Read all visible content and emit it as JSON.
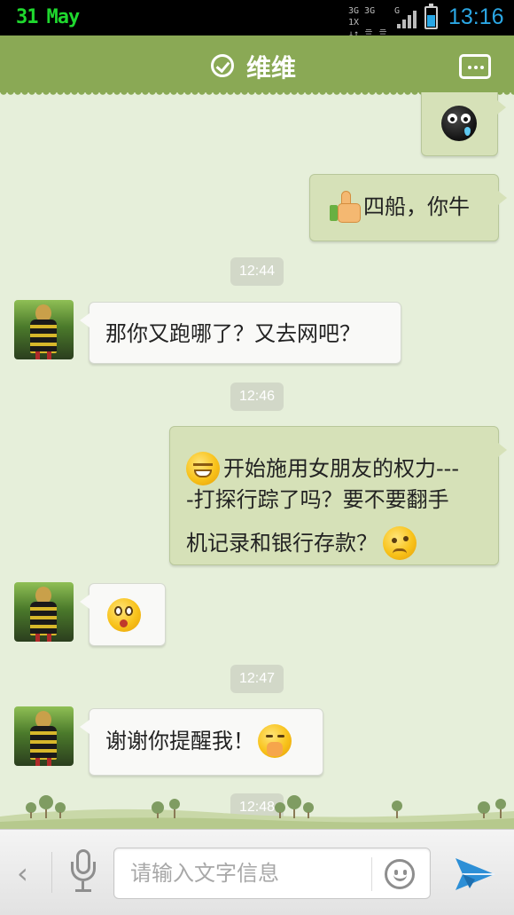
{
  "status_bar": {
    "date_day": "31",
    "date_month": "May",
    "network_line1": "3G 3G 1X",
    "network_line2": "↓↑ 亖 亖",
    "network_g": "G",
    "battery_level": 0.6,
    "time": "13:16",
    "date_color": "#1fd82e",
    "time_color": "#2ba7e4"
  },
  "header": {
    "title": "维维",
    "verified_icon": "check-circle-icon",
    "menu_icon": "more-dots-icon",
    "background": "#8aa955"
  },
  "messages": [
    {
      "dir": "out",
      "type": "sticker",
      "sticker": "crying-bomb-icon"
    },
    {
      "dir": "out",
      "type": "text",
      "emoji": "thumbs-up-icon",
      "text": "四船，你牛"
    },
    {
      "type": "time",
      "text": "12:44"
    },
    {
      "dir": "in",
      "type": "text",
      "text": "那你又跑哪了？又去网吧？"
    },
    {
      "type": "time",
      "text": "12:46"
    },
    {
      "dir": "out",
      "type": "text",
      "emoji": "grin-emoji-icon",
      "lines": [
        "开始施用女朋友的权力---",
        "-打探行踪了吗？要不要翻手",
        "机记录和银行存款？"
      ],
      "trail_emoji": "confused-emoji-icon"
    },
    {
      "dir": "in",
      "type": "sticker",
      "sticker": "surprised-emoji-icon"
    },
    {
      "type": "time",
      "text": "12:47"
    },
    {
      "dir": "in",
      "type": "text",
      "text": "谢谢你提醒我！",
      "trail_emoji": "shy-emoji-icon"
    },
    {
      "type": "time",
      "text": "12:48"
    }
  ],
  "input_bar": {
    "back_glyph": "‹",
    "placeholder": "请输入文字信息",
    "value": "",
    "mic_icon": "microphone-icon",
    "emoji_icon": "smiley-icon",
    "send_icon": "send-plane-icon",
    "send_color": "#2d8fd6"
  }
}
